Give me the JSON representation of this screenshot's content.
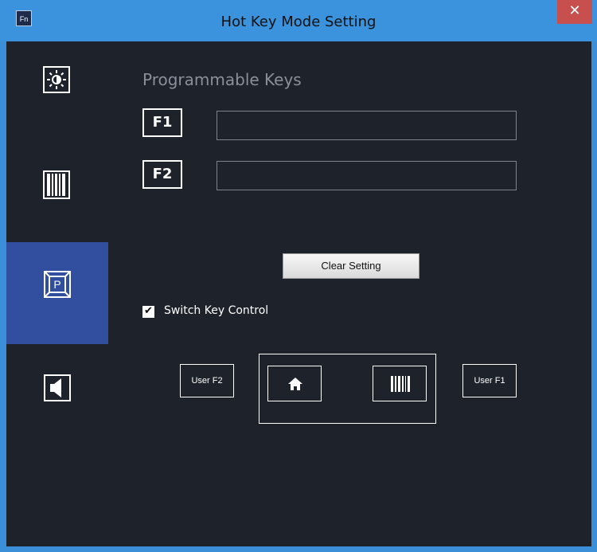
{
  "window": {
    "title": "Hot Key Mode Setting",
    "app_icon_text": "Fn",
    "close_glyph": "✕"
  },
  "sidebar": {
    "items": [
      {
        "name": "brightness",
        "icon": "brightness-icon"
      },
      {
        "name": "barcode",
        "icon": "barcode-icon"
      },
      {
        "name": "programmable",
        "icon": "programmable-key-icon",
        "active": true,
        "glyph": "P"
      },
      {
        "name": "sound",
        "icon": "speaker-icon"
      }
    ]
  },
  "main": {
    "heading": "Programmable Keys",
    "keys": [
      {
        "label": "F1",
        "value": ""
      },
      {
        "label": "F2",
        "value": ""
      }
    ],
    "clear_button": "Clear Setting",
    "switch_control": {
      "label": "Switch Key Control",
      "checked": true,
      "check_glyph": "✔"
    },
    "switch_buttons": {
      "user_f2": "User F2",
      "home_icon": "home-icon",
      "barcode_icon": "barcode-icon",
      "user_f1": "User F1"
    }
  },
  "colors": {
    "titlebar": "#3a93dc",
    "client_bg": "#1e222a",
    "active_sidebar": "#314e9f",
    "close_button": "#c7504f"
  }
}
